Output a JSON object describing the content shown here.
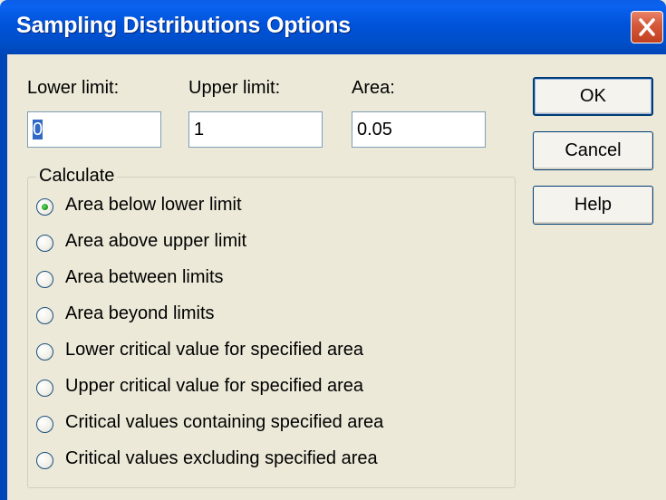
{
  "window": {
    "title": "Sampling Distributions Options",
    "close_label": "close"
  },
  "fields": {
    "lower": {
      "label": "Lower limit:",
      "value": "0"
    },
    "upper": {
      "label": "Upper limit:",
      "value": "1"
    },
    "area": {
      "label": "Area:",
      "value": "0.05"
    }
  },
  "buttons": {
    "ok": "OK",
    "cancel": "Cancel",
    "help": "Help"
  },
  "calculate": {
    "title": "Calculate",
    "selected_index": 0,
    "options": [
      "Area below lower limit",
      "Area above upper limit",
      "Area between limits",
      "Area beyond limits",
      "Lower critical value for specified area",
      "Upper critical value for specified area",
      "Critical values containing specified area",
      "Critical values excluding specified area"
    ]
  },
  "colors": {
    "titlebar": "#0052d9",
    "close_button": "#d65a3c",
    "dialog_background": "#ece9d8",
    "selection": "#316ac5",
    "radio_checked": "#21a121"
  },
  "icons": {
    "close": "close-icon",
    "radio": "radio-button"
  }
}
